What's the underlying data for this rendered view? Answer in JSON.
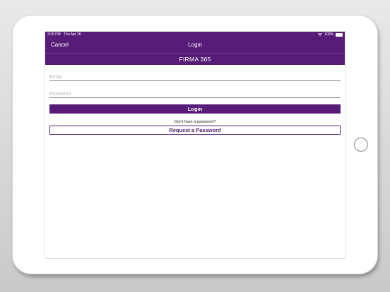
{
  "status_bar": {
    "time": "3:26 PM",
    "date": "Thu Apr 18",
    "signal": "....",
    "battery_percent": "100%",
    "battery_level": 1.0
  },
  "nav": {
    "cancel_label": "Cancel",
    "title": "Login"
  },
  "brand": {
    "title": "FIRMA 365"
  },
  "form": {
    "email_placeholder": "Email",
    "email_value": "",
    "password_placeholder": "Password",
    "password_value": "",
    "login_label": "Login",
    "no_password_hint": "Don't have a password?",
    "request_label": "Request a Password"
  },
  "colors": {
    "accent": "#561c78",
    "field_underline": "#8d8d8d",
    "background": "#ffffff"
  },
  "icons": {
    "wifi": "wifi-icon",
    "battery": "battery-icon",
    "home_button": "home-button"
  }
}
